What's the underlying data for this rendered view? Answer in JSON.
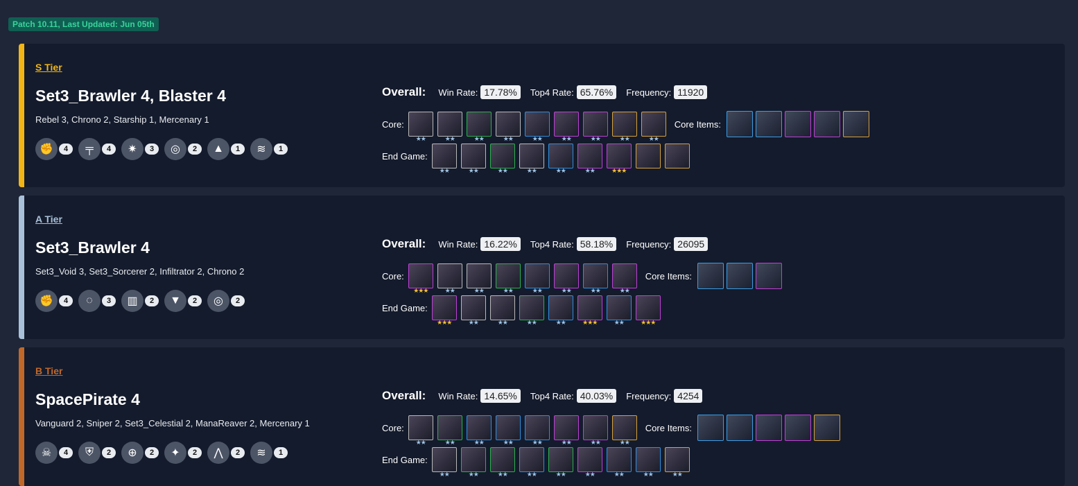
{
  "patch_label": "Patch 10.11, Last Updated: Jun 05th",
  "labels": {
    "overall": "Overall:",
    "win_rate": "Win Rate:",
    "top4_rate": "Top4 Rate:",
    "frequency": "Frequency:",
    "core": "Core:",
    "core_items": "Core Items:",
    "end_game": "End Game:"
  },
  "comps": [
    {
      "tier": "S Tier",
      "tier_color": "#f1b616",
      "name": "Set3_Brawler 4, Blaster 4",
      "traits_text": "Rebel 3, Chrono 2, Starship 1, Mercenary 1",
      "traits": [
        {
          "icon": "fist-icon",
          "count": "4"
        },
        {
          "icon": "gun-icon",
          "count": "4"
        },
        {
          "icon": "rebel-icon",
          "count": "3"
        },
        {
          "icon": "chrono-icon",
          "count": "2"
        },
        {
          "icon": "starship-icon",
          "count": "1"
        },
        {
          "icon": "mercenary-icon",
          "count": "1"
        }
      ],
      "win_rate": "17.78%",
      "top4_rate": "65.76%",
      "frequency": "11920",
      "core": [
        {
          "border": "#b9b9b9",
          "stars": 2,
          "gold": false
        },
        {
          "border": "#b9b9b9",
          "stars": 2,
          "gold": false
        },
        {
          "border": "#2bb24c",
          "stars": 2,
          "gold": false
        },
        {
          "border": "#b9b9b9",
          "stars": 2,
          "gold": false
        },
        {
          "border": "#2e8fe0",
          "stars": 2,
          "gold": false
        },
        {
          "border": "#c03fd8",
          "stars": 2,
          "gold": false
        },
        {
          "border": "#c03fd8",
          "stars": 2,
          "gold": false
        },
        {
          "border": "#d8a23a",
          "stars": 2,
          "gold": false
        },
        {
          "border": "#d8a23a",
          "stars": 2,
          "gold": false
        }
      ],
      "core_items_count": 5,
      "end_game": [
        {
          "border": "#b9b9b9",
          "stars": 2,
          "gold": false
        },
        {
          "border": "#b9b9b9",
          "stars": 2,
          "gold": false
        },
        {
          "border": "#2bb24c",
          "stars": 2,
          "gold": false
        },
        {
          "border": "#b9b9b9",
          "stars": 2,
          "gold": false
        },
        {
          "border": "#2e8fe0",
          "stars": 2,
          "gold": false
        },
        {
          "border": "#c03fd8",
          "stars": 2,
          "gold": false
        },
        {
          "border": "#c03fd8",
          "stars": 3,
          "gold": true
        },
        {
          "border": "#d8a23a",
          "stars": 0,
          "gold": false
        },
        {
          "border": "#d8a23a",
          "stars": 0,
          "gold": false
        }
      ]
    },
    {
      "tier": "A Tier",
      "tier_color": "#a9c1d8",
      "name": "Set3_Brawler 4",
      "traits_text": "Set3_Void 3, Set3_Sorcerer 2, Infiltrator 2, Chrono 2",
      "traits": [
        {
          "icon": "fist-icon",
          "count": "4"
        },
        {
          "icon": "void-icon",
          "count": "3"
        },
        {
          "icon": "book-icon",
          "count": "2"
        },
        {
          "icon": "mask-icon",
          "count": "2"
        },
        {
          "icon": "chrono-icon",
          "count": "2"
        }
      ],
      "win_rate": "16.22%",
      "top4_rate": "58.18%",
      "frequency": "26095",
      "core": [
        {
          "border": "#c03fd8",
          "stars": 3,
          "gold": true
        },
        {
          "border": "#b9b9b9",
          "stars": 2,
          "gold": false
        },
        {
          "border": "#b9b9b9",
          "stars": 2,
          "gold": false
        },
        {
          "border": "#2bb24c",
          "stars": 2,
          "gold": false
        },
        {
          "border": "#2e8fe0",
          "stars": 2,
          "gold": false
        },
        {
          "border": "#c03fd8",
          "stars": 2,
          "gold": false
        },
        {
          "border": "#2e8fe0",
          "stars": 2,
          "gold": false
        },
        {
          "border": "#c03fd8",
          "stars": 2,
          "gold": false
        }
      ],
      "core_items_count": 3,
      "end_game": [
        {
          "border": "#c03fd8",
          "stars": 3,
          "gold": true
        },
        {
          "border": "#b9b9b9",
          "stars": 2,
          "gold": false
        },
        {
          "border": "#b9b9b9",
          "stars": 2,
          "gold": false
        },
        {
          "border": "#2bb24c",
          "stars": 2,
          "gold": false
        },
        {
          "border": "#2e8fe0",
          "stars": 2,
          "gold": false
        },
        {
          "border": "#c03fd8",
          "stars": 3,
          "gold": true
        },
        {
          "border": "#2e8fe0",
          "stars": 2,
          "gold": false
        },
        {
          "border": "#c03fd8",
          "stars": 3,
          "gold": true
        }
      ]
    },
    {
      "tier": "B Tier",
      "tier_color": "#c0682a",
      "name": "SpacePirate 4",
      "traits_text": "Vanguard 2, Sniper 2, Set3_Celestial 2, ManaReaver 2, Mercenary 1",
      "traits": [
        {
          "icon": "skull-icon",
          "count": "4"
        },
        {
          "icon": "helmet-icon",
          "count": "2"
        },
        {
          "icon": "crosshair-icon",
          "count": "2"
        },
        {
          "icon": "celestial-icon",
          "count": "2"
        },
        {
          "icon": "manareaver-icon",
          "count": "2"
        },
        {
          "icon": "mercenary-icon",
          "count": "1"
        }
      ],
      "win_rate": "14.65%",
      "top4_rate": "40.03%",
      "frequency": "4254",
      "core": [
        {
          "border": "#b9b9b9",
          "stars": 2,
          "gold": false
        },
        {
          "border": "#2bb24c",
          "stars": 2,
          "gold": false
        },
        {
          "border": "#2e8fe0",
          "stars": 2,
          "gold": false
        },
        {
          "border": "#2e8fe0",
          "stars": 2,
          "gold": false
        },
        {
          "border": "#2e8fe0",
          "stars": 2,
          "gold": false
        },
        {
          "border": "#c03fd8",
          "stars": 2,
          "gold": false
        },
        {
          "border": "#c03fd8",
          "stars": 2,
          "gold": false
        },
        {
          "border": "#d8a23a",
          "stars": 2,
          "gold": false
        }
      ],
      "core_items_count": 5,
      "end_game": [
        {
          "border": "#b9b9b9",
          "stars": 2,
          "gold": false
        },
        {
          "border": "#2bb24c",
          "stars": 2,
          "gold": false
        },
        {
          "border": "#2bb24c",
          "stars": 2,
          "gold": false
        },
        {
          "border": "#2e8fe0",
          "stars": 2,
          "gold": false
        },
        {
          "border": "#2bb24c",
          "stars": 2,
          "gold": false
        },
        {
          "border": "#c03fd8",
          "stars": 2,
          "gold": false
        },
        {
          "border": "#2e8fe0",
          "stars": 2,
          "gold": false
        },
        {
          "border": "#2e8fe0",
          "stars": 2,
          "gold": false
        },
        {
          "border": "#d8a23a",
          "stars": 2,
          "gold": false
        }
      ]
    }
  ]
}
